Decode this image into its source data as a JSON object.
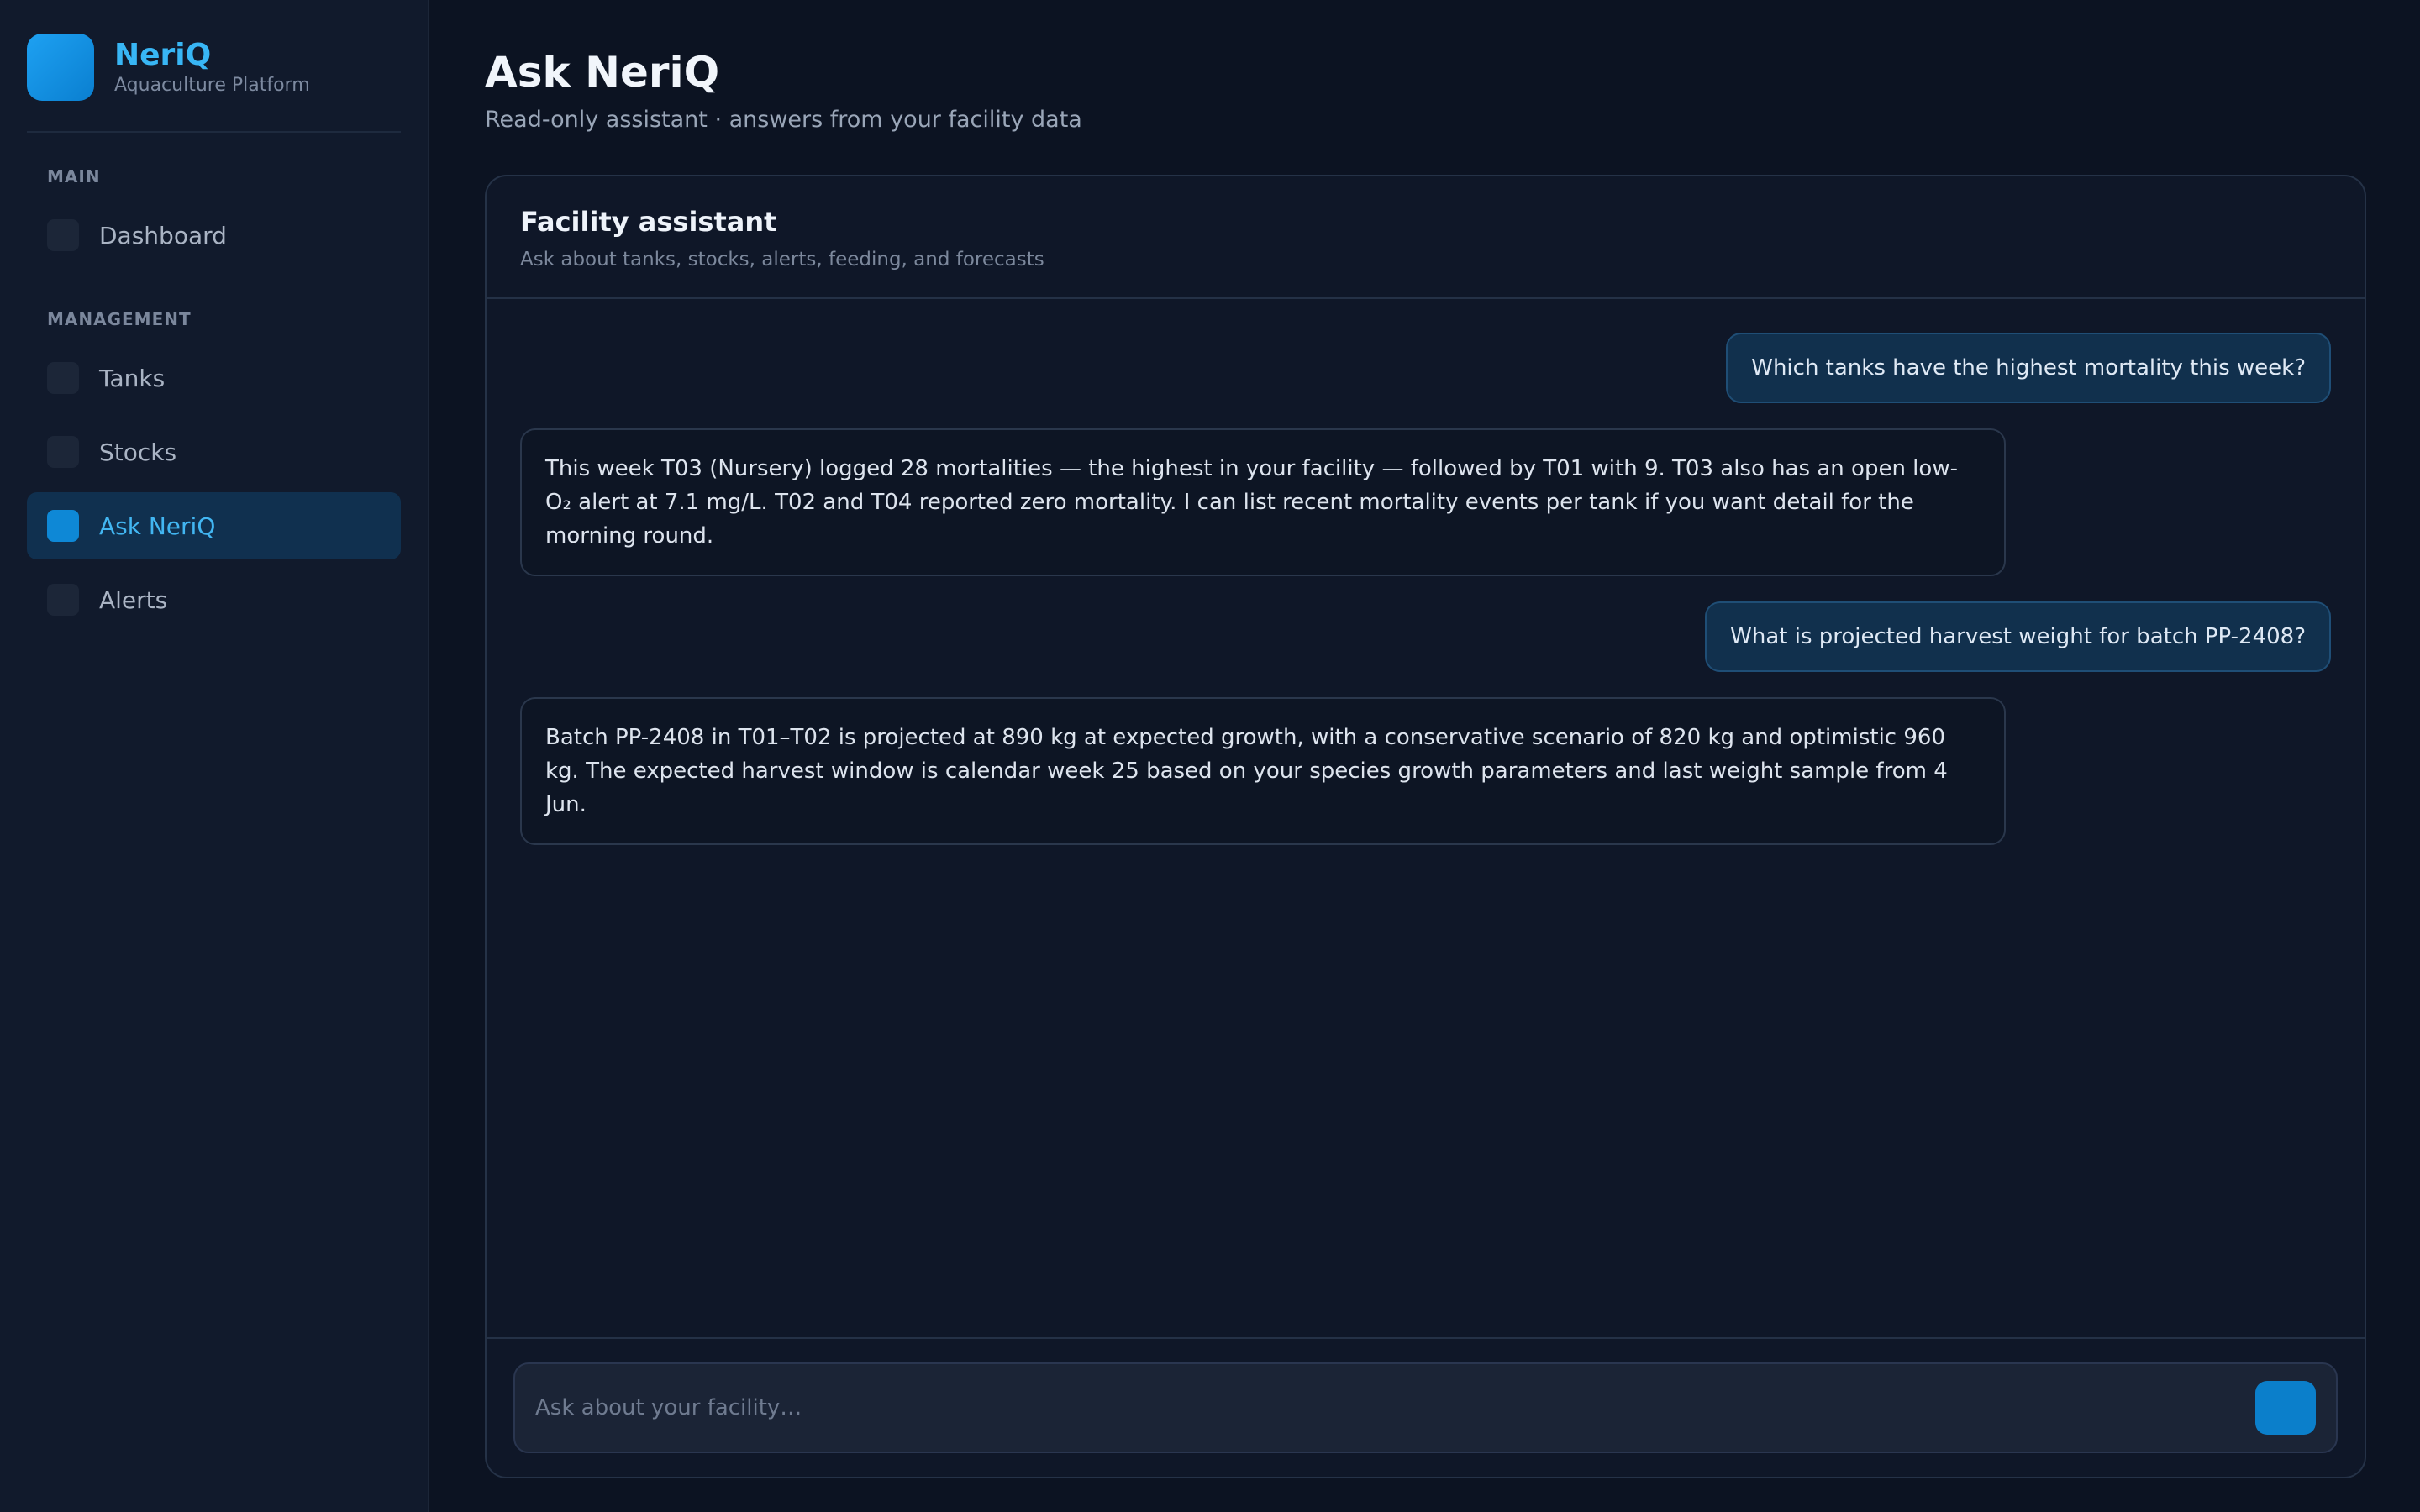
{
  "brand": {
    "name": "NeriQ",
    "subtitle": "Aquaculture Platform"
  },
  "sidebar": {
    "sections": [
      {
        "label": "MAIN"
      },
      {
        "label": "MANAGEMENT"
      }
    ],
    "items": [
      {
        "label": "Dashboard",
        "icon": "dashboard-icon"
      },
      {
        "label": "Tanks",
        "icon": "tanks-icon"
      },
      {
        "label": "Stocks",
        "icon": "stocks-icon"
      },
      {
        "label": "Ask NeriQ",
        "icon": "ask-icon",
        "active": true
      },
      {
        "label": "Alerts",
        "icon": "alerts-icon"
      }
    ]
  },
  "page": {
    "title": "Ask NeriQ",
    "subtitle": "Read-only assistant · answers from your facility data"
  },
  "assistant": {
    "title": "Facility assistant",
    "subtitle": "Ask about tanks, stocks, alerts, feeding, and forecasts",
    "messages": [
      {
        "role": "user",
        "text": "Which tanks have the highest mortality this week?"
      },
      {
        "role": "assistant",
        "text": "This week T03 (Nursery) logged 28 mortalities — the highest in your facility — followed by T01 with 9. T03 also has an open low-O₂ alert at 7.1 mg/L. T02 and T04 reported zero mortality. I can list recent mortality events per tank if you want detail for the morning round."
      },
      {
        "role": "user",
        "text": "What is projected harvest weight for batch PP-2408?"
      },
      {
        "role": "assistant",
        "text": "Batch PP-2408 in T01–T02 is projected at 890 kg at expected growth, with a conservative scenario of 820 kg and optimistic 960 kg. The expected harvest window is calendar week 25 based on your species growth parameters and last weight sample from 4 Jun."
      }
    ],
    "composer": {
      "placeholder": "Ask about your facility…",
      "value": ""
    }
  },
  "colors": {
    "accent": "#0e88d6",
    "brand": "#38b6f5",
    "background": "#0c1322",
    "sidebar": "#111a2c"
  }
}
